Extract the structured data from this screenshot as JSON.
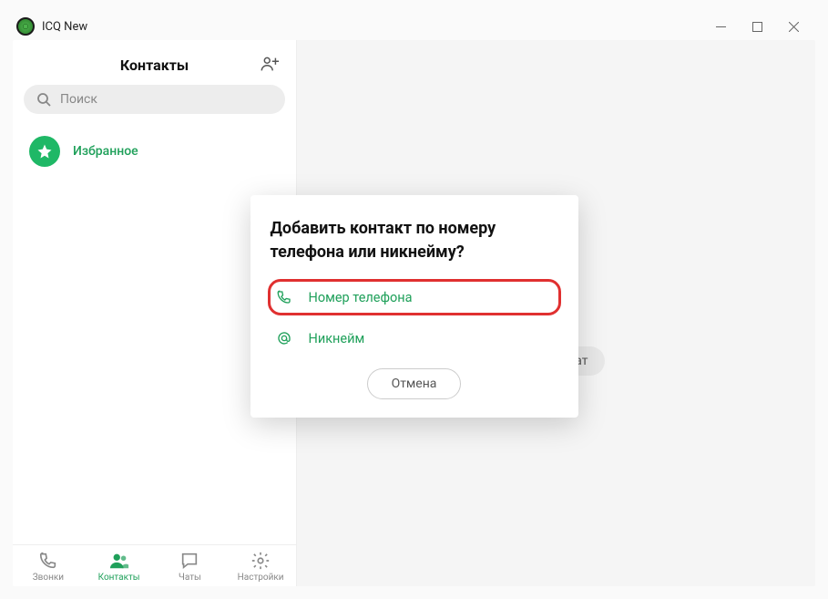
{
  "titlebar": {
    "title": "ICQ New"
  },
  "sidebar": {
    "title": "Контакты",
    "search_placeholder": "Поиск",
    "favorites_label": "Избранное"
  },
  "nav": {
    "calls": "Звонки",
    "contacts": "Контакты",
    "chats": "Чаты",
    "settings": "Настройки"
  },
  "main": {
    "select_chat": "берите чат"
  },
  "modal": {
    "title": "Добавить контакт по номеру телефона или никнейму?",
    "phone_option": "Номер телефона",
    "nickname_option": "Никнейм",
    "cancel": "Отмена"
  }
}
